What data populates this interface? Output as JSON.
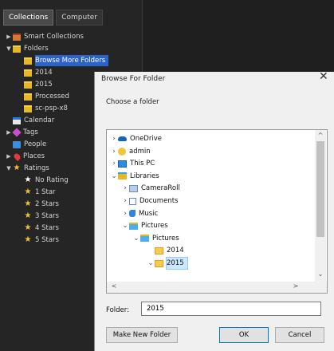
{
  "library": {
    "tabs": [
      "Collections",
      "Computer"
    ],
    "items": [
      {
        "label": "Smart Collections",
        "kind": "smart",
        "arrow": "▶"
      },
      {
        "label": "Folders",
        "kind": "folder",
        "arrow": "▼"
      },
      {
        "label": "Browse More Folders",
        "kind": "folder",
        "arrow": "",
        "selected": true
      },
      {
        "label": "2014",
        "kind": "folder"
      },
      {
        "label": "2015",
        "kind": "folder"
      },
      {
        "label": "Processed",
        "kind": "folder"
      },
      {
        "label": "sc-psp-x8",
        "kind": "folder"
      },
      {
        "label": "Calendar",
        "kind": "calendar"
      },
      {
        "label": "Tags",
        "kind": "tag",
        "arrow": "▶"
      },
      {
        "label": "People",
        "kind": "people"
      },
      {
        "label": "Places",
        "kind": "place",
        "arrow": "▶"
      },
      {
        "label": "Ratings",
        "kind": "star",
        "arrow": "▼"
      },
      {
        "label": "No Rating",
        "kind": "star-white"
      },
      {
        "label": "1 Star",
        "kind": "star"
      },
      {
        "label": "2 Stars",
        "kind": "star"
      },
      {
        "label": "3 Stars",
        "kind": "star"
      },
      {
        "label": "4 Stars",
        "kind": "star"
      },
      {
        "label": "5 Stars",
        "kind": "star"
      }
    ]
  },
  "dialog": {
    "title": "Browse For Folder",
    "close": "✕",
    "prompt": "Choose a folder",
    "tree": [
      {
        "label": "OneDrive",
        "caret": "›",
        "icon": "onedrive-icon"
      },
      {
        "label": "admin",
        "caret": "›",
        "icon": "user-folder-icon"
      },
      {
        "label": "This PC",
        "caret": "›",
        "icon": "computer-icon"
      },
      {
        "label": "Libraries",
        "caret": "⌄",
        "icon": "libraries-icon"
      },
      {
        "label": "CameraRoll",
        "caret": "›",
        "icon": "library-icon"
      },
      {
        "label": "Documents",
        "caret": "›",
        "icon": "documents-icon"
      },
      {
        "label": "Music",
        "caret": "›",
        "icon": "music-icon"
      },
      {
        "label": "Pictures",
        "caret": "⌄",
        "icon": "pictures-library-icon"
      },
      {
        "label": "Pictures",
        "caret": "⌄",
        "icon": "pictures-folder-icon"
      },
      {
        "label": "2014",
        "caret": "",
        "icon": "folder-icon"
      },
      {
        "label": "2015",
        "caret": "⌄",
        "icon": "folder-icon",
        "selected": true
      }
    ],
    "folder_label": "Folder:",
    "folder_value": "2015",
    "buttons": {
      "new_folder": "Make New Folder",
      "ok": "OK",
      "cancel": "Cancel"
    }
  }
}
